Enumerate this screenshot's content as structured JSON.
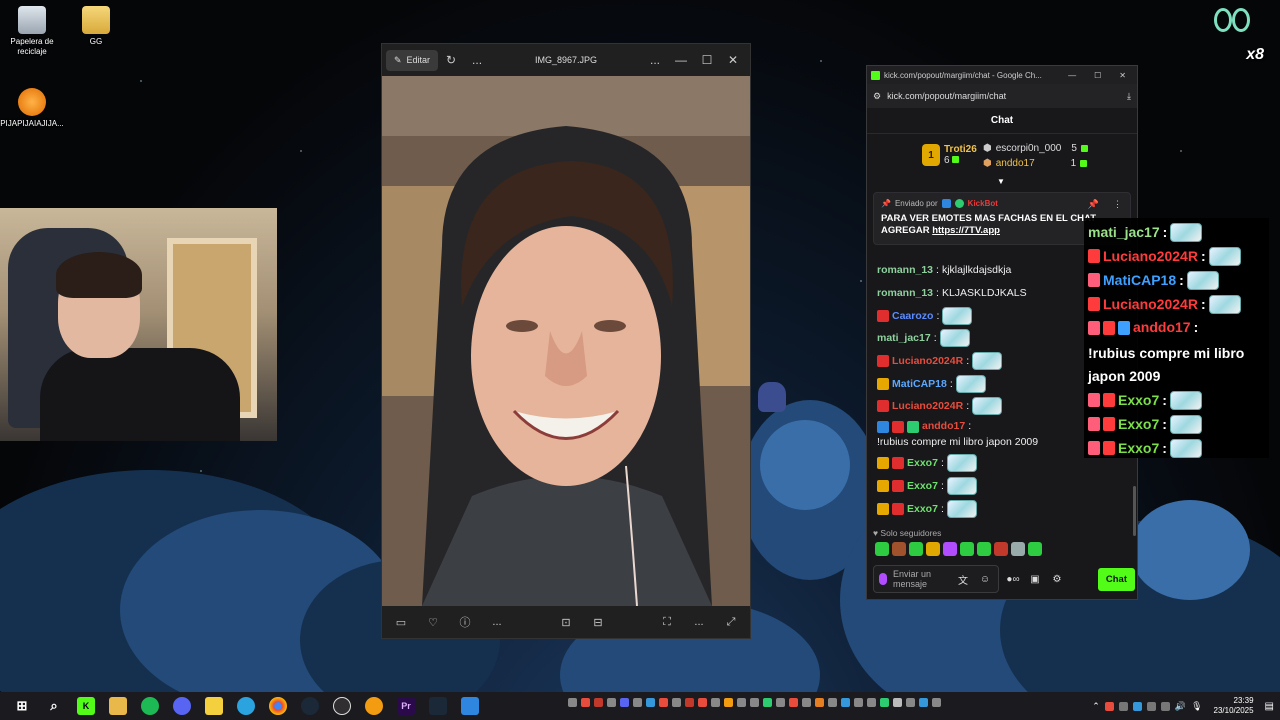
{
  "desktop": {
    "icons": [
      {
        "label": "Papelera de reciclaje"
      },
      {
        "label": "GG"
      },
      {
        "label": "PIJAPIJAIAJIJA..."
      }
    ]
  },
  "photo_viewer": {
    "edit_label": "Editar",
    "filename": "IMG_8967.JPG",
    "more": "...",
    "minimize": "—",
    "maximize": "☐",
    "close": "✕"
  },
  "chat_window": {
    "title": "kick.com/popout/margiim/chat - Google Ch...",
    "url": "kick.com/popout/margiim/chat",
    "header": "Chat",
    "leaderboard": {
      "first": {
        "rank": "1",
        "name": "Troti26",
        "count": "6"
      },
      "rows": [
        {
          "name": "escorpi0n_000",
          "count": "5"
        },
        {
          "name": "anddo17",
          "count": "1"
        }
      ]
    },
    "pinned": {
      "sent_by": "Enviado por",
      "bot": "KickBot",
      "text": "PARA VER EMOTES MAS FACHAS EN EL CHAT AGREGAR",
      "link": "https://7TV.app"
    },
    "messages": [
      {
        "user": "romann_13",
        "color": "#8fd19e",
        "text": "kjklajlkdajsdkja"
      },
      {
        "user": "romann_13",
        "color": "#8fd19e",
        "text": "KLJASKLDJKALS"
      },
      {
        "user": "Caarozo",
        "color": "#5b8cff",
        "text": ""
      },
      {
        "user": "mati_jac17",
        "color": "#8fd19e",
        "text": ""
      },
      {
        "user": "Luciano2024R",
        "color": "#e74c3c",
        "text": ""
      },
      {
        "user": "MatiCAP18",
        "color": "#5aa9ff",
        "text": ""
      },
      {
        "user": "Luciano2024R",
        "color": "#e74c3c",
        "text": ""
      },
      {
        "user": "anddo17",
        "color": "#e74c3c",
        "text": "!rubius compre mi libro japon 2009"
      },
      {
        "user": "Exxo7",
        "color": "#6ee06e",
        "text": ""
      },
      {
        "user": "Exxo7",
        "color": "#6ee06e",
        "text": ""
      },
      {
        "user": "Exxo7",
        "color": "#6ee06e",
        "text": ""
      }
    ],
    "solo_seguidores": "Solo seguidores",
    "input_placeholder": "Enviar un mensaje",
    "send_label": "Chat"
  },
  "overlay_chat": {
    "lines": [
      {
        "user": "mati_jac17",
        "color": "#9be28a",
        "text": ""
      },
      {
        "user": "Luciano2024R",
        "color": "#ff3b3b",
        "text": ""
      },
      {
        "user": "MatiCAP18",
        "color": "#3fa1ff",
        "text": ""
      },
      {
        "user": "Luciano2024R",
        "color": "#ff3b3b",
        "text": ""
      },
      {
        "user": "anddo17",
        "color": "#ff3b3b",
        "text": "!rubius compre mi libro japon 2009"
      },
      {
        "user": "Exxo7",
        "color": "#7be04a",
        "text": ""
      },
      {
        "user": "Exxo7",
        "color": "#7be04a",
        "text": ""
      },
      {
        "user": "Exxo7",
        "color": "#7be04a",
        "text": ""
      }
    ]
  },
  "corner": {
    "multiplier": "x8"
  },
  "taskbar": {
    "clock_time": "23:39",
    "clock_date": "23/10/2025"
  },
  "colors": {
    "kick_green": "#53fc18",
    "taskbar": "#1b1b1f"
  }
}
